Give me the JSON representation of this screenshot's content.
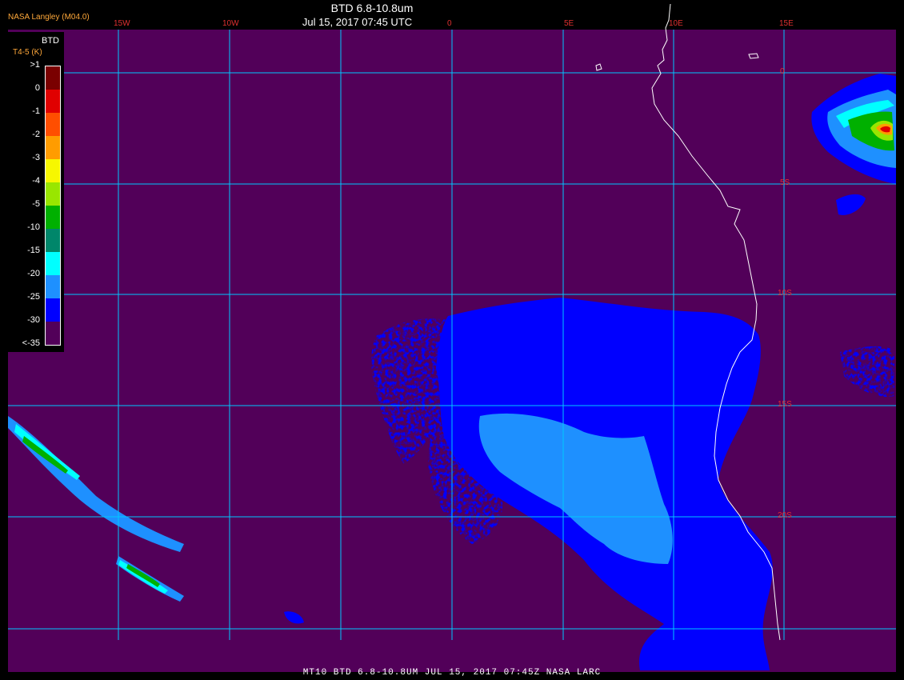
{
  "header": {
    "title": "BTD 6.8-10.8um",
    "date": "Jul 15, 2017 07:45 UTC",
    "source": "NASA Langley (M04.0)"
  },
  "footer": {
    "text": "MT10  BTD 6.8-10.8UM   JUL 15, 2017 07:45Z   NASA LARC"
  },
  "legend": {
    "title": "BTD",
    "subtitle": "T4-5 (K)",
    "ticks": [
      ">1",
      "0",
      "-1",
      "-2",
      "-3",
      "-4",
      "-5",
      "-10",
      "-15",
      "-20",
      "-25",
      "-30",
      "<-35"
    ],
    "colors": [
      "#7a0000",
      "#e00000",
      "#ff4e00",
      "#ff9c00",
      "#f7f700",
      "#99e600",
      "#00b000",
      "#00866a",
      "#00ffff",
      "#1e90ff",
      "#0000ff",
      "#520059"
    ]
  },
  "map": {
    "background_color": "#520059",
    "grid_color": "#00c8ff",
    "coast_color": "#ffffff",
    "lon_labels": [
      "15W",
      "10W",
      "0",
      "5E",
      "10E",
      "15E"
    ],
    "lat_labels": [
      "0",
      "5S",
      "10S",
      "15S",
      "20S"
    ]
  }
}
